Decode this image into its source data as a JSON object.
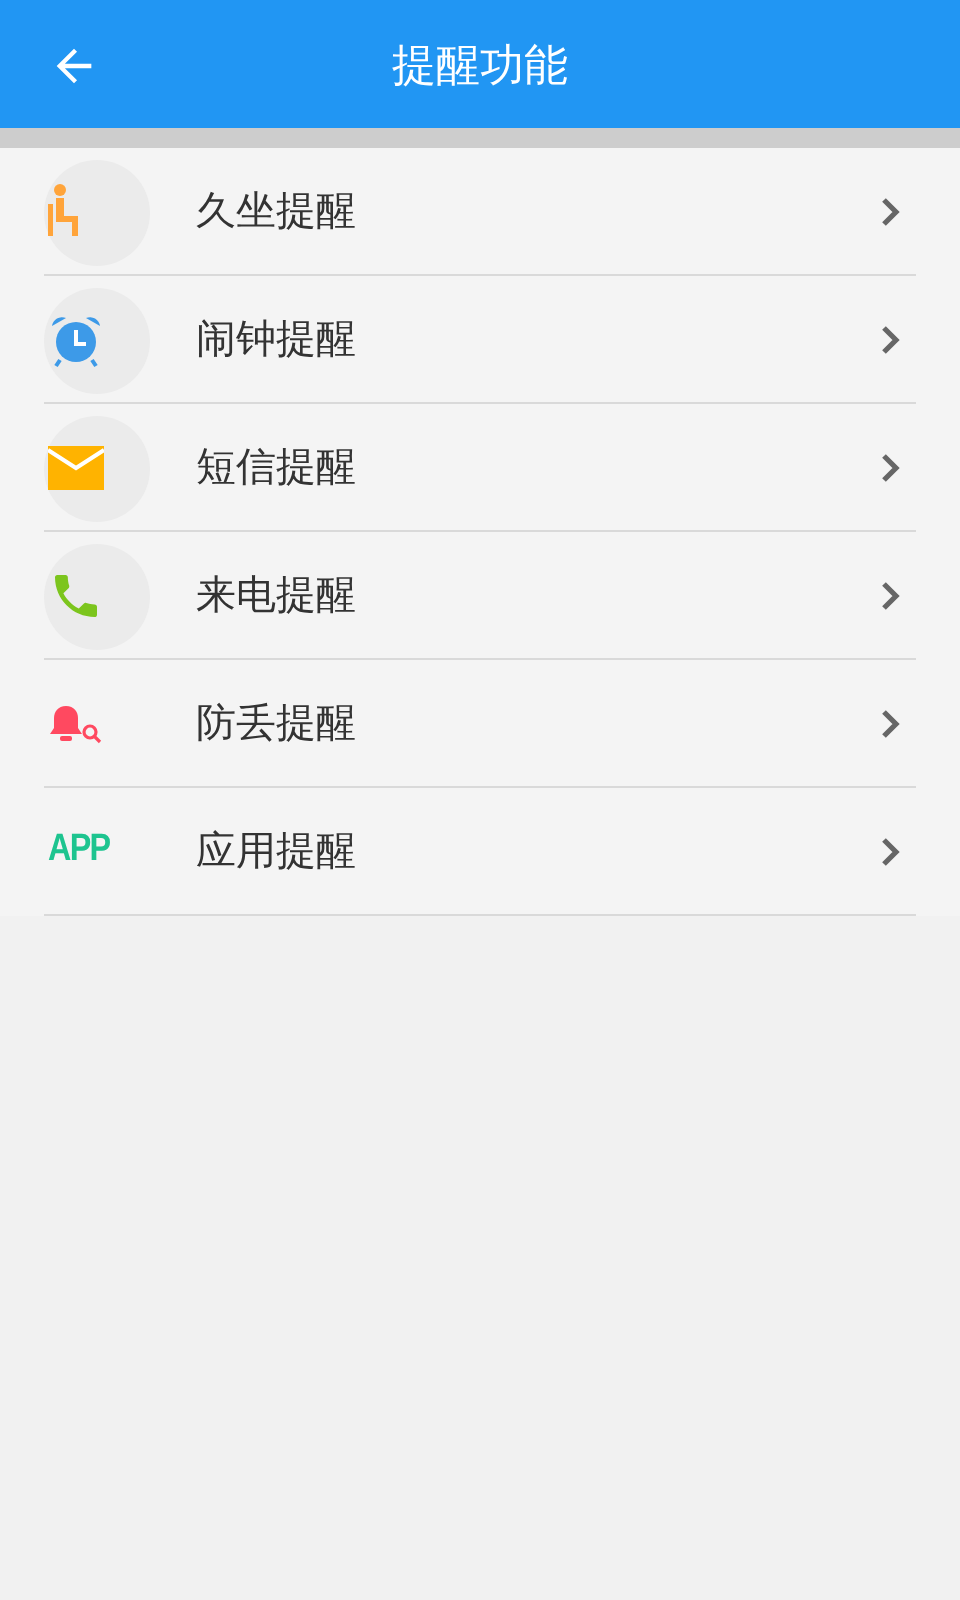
{
  "header": {
    "title": "提醒功能"
  },
  "items": [
    {
      "kind": "sitting",
      "label": "久坐提醒"
    },
    {
      "kind": "alarm",
      "label": "闹钟提醒"
    },
    {
      "kind": "message",
      "label": "短信提醒"
    },
    {
      "kind": "call",
      "label": "来电提醒"
    },
    {
      "kind": "antilost",
      "label": "防丢提醒"
    },
    {
      "kind": "app",
      "label": "应用提醒",
      "icon_text": "APP"
    }
  ]
}
